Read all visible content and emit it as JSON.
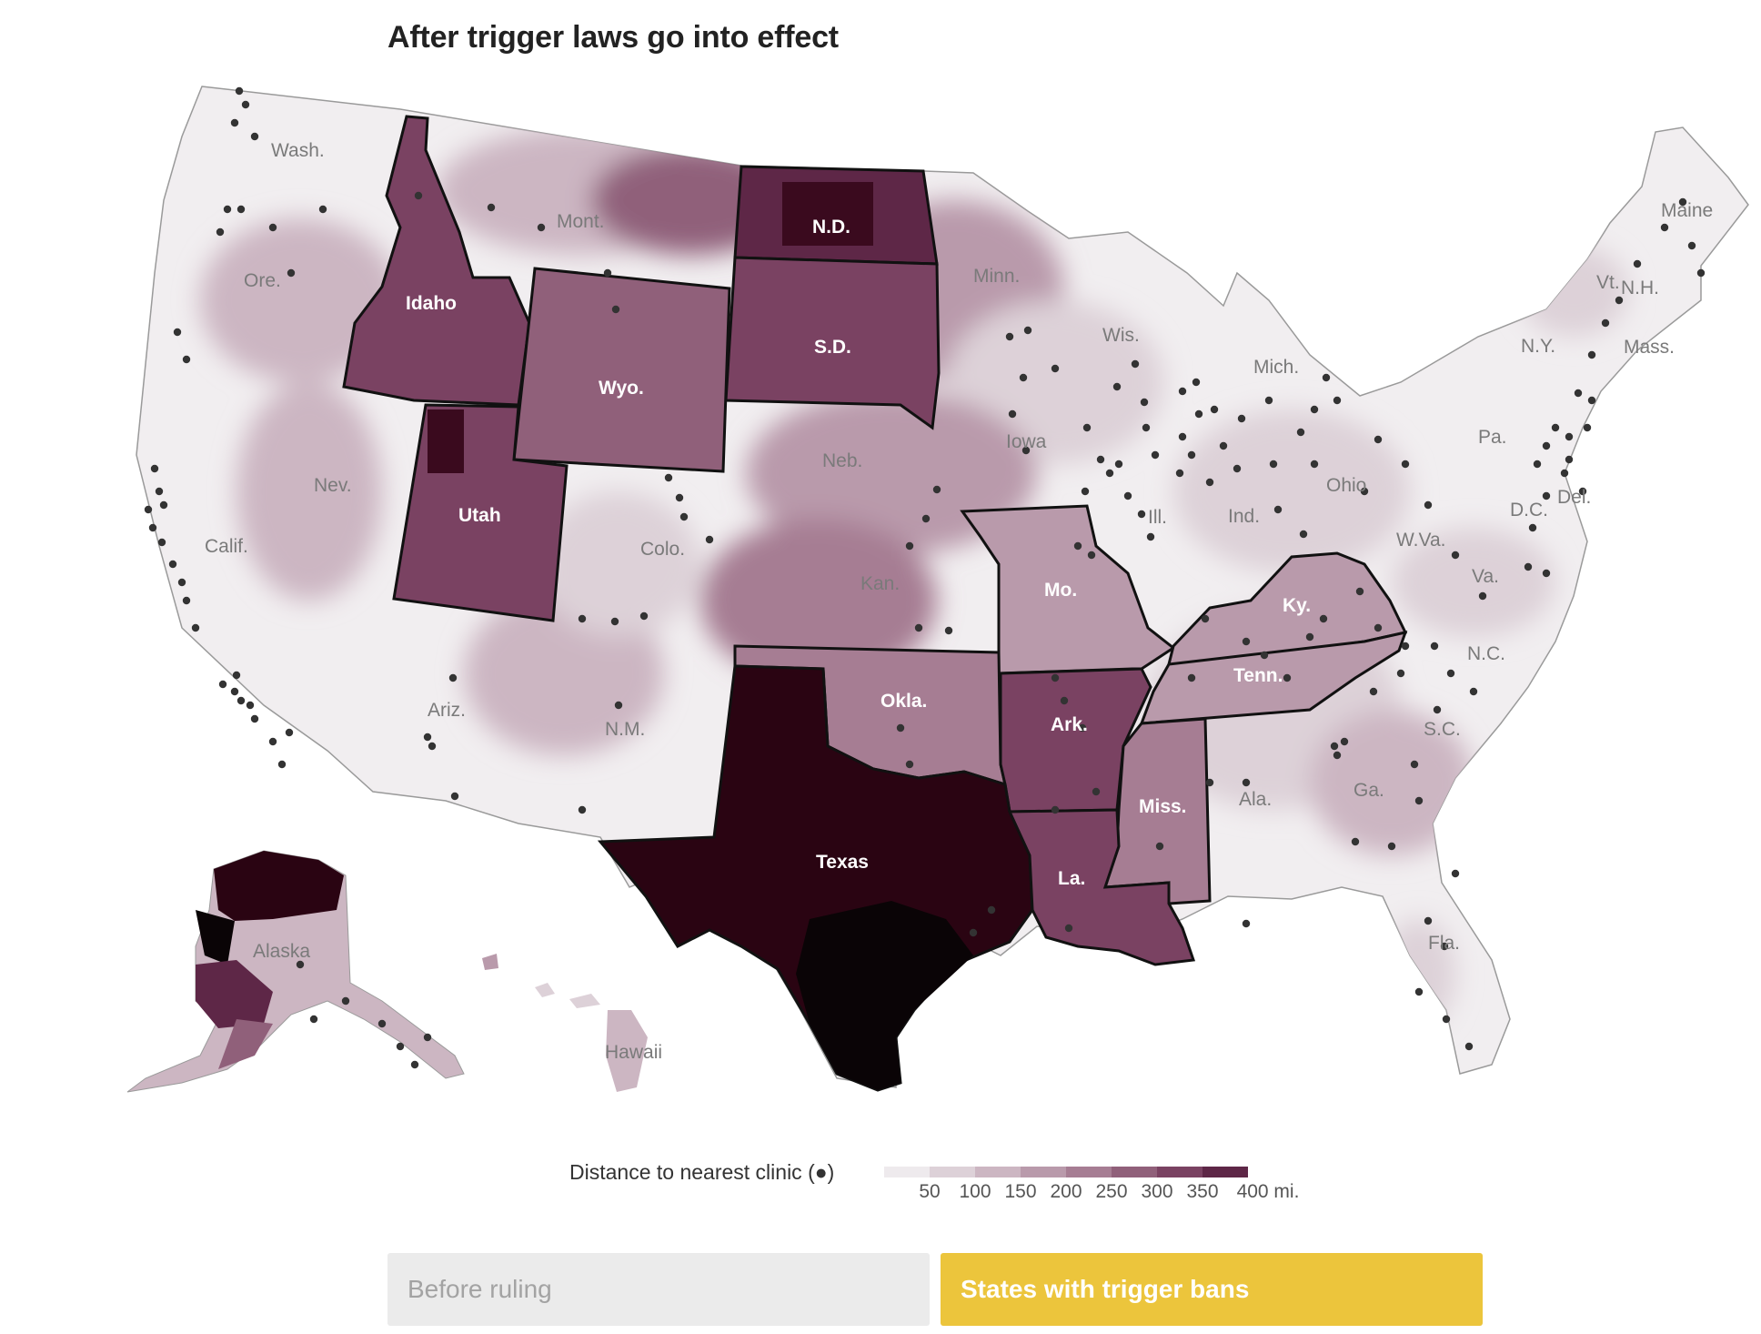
{
  "headline": "After trigger laws go into effect",
  "map": {
    "state_labels_gray": [
      {
        "id": "wash",
        "text": "Wash."
      },
      {
        "id": "ore",
        "text": "Ore."
      },
      {
        "id": "calif",
        "text": "Calif."
      },
      {
        "id": "nev",
        "text": "Nev."
      },
      {
        "id": "mont",
        "text": "Mont."
      },
      {
        "id": "ariz",
        "text": "Ariz."
      },
      {
        "id": "colo",
        "text": "Colo."
      },
      {
        "id": "nm",
        "text": "N.M."
      },
      {
        "id": "neb",
        "text": "Neb."
      },
      {
        "id": "kan",
        "text": "Kan."
      },
      {
        "id": "minn",
        "text": "Minn."
      },
      {
        "id": "iowa",
        "text": "Iowa"
      },
      {
        "id": "wis",
        "text": "Wis."
      },
      {
        "id": "mich",
        "text": "Mich."
      },
      {
        "id": "ill",
        "text": "Ill."
      },
      {
        "id": "ind",
        "text": "Ind."
      },
      {
        "id": "ohio",
        "text": "Ohio"
      },
      {
        "id": "pa",
        "text": "Pa."
      },
      {
        "id": "ny",
        "text": "N.Y."
      },
      {
        "id": "vt",
        "text": "Vt."
      },
      {
        "id": "nh",
        "text": "N.H."
      },
      {
        "id": "mass",
        "text": "Mass."
      },
      {
        "id": "maine",
        "text": "Maine"
      },
      {
        "id": "del",
        "text": "Del."
      },
      {
        "id": "dc",
        "text": "D.C."
      },
      {
        "id": "wva",
        "text": "W.Va."
      },
      {
        "id": "va",
        "text": "Va."
      },
      {
        "id": "nc",
        "text": "N.C."
      },
      {
        "id": "sc",
        "text": "S.C."
      },
      {
        "id": "ga",
        "text": "Ga."
      },
      {
        "id": "ala",
        "text": "Ala."
      },
      {
        "id": "fla",
        "text": "Fla."
      },
      {
        "id": "alaska",
        "text": "Alaska"
      },
      {
        "id": "hawaii",
        "text": "Hawaii"
      }
    ],
    "state_labels_trigger": [
      {
        "id": "nd",
        "text": "N.D."
      },
      {
        "id": "sd",
        "text": "S.D."
      },
      {
        "id": "idaho",
        "text": "Idaho"
      },
      {
        "id": "wyo",
        "text": "Wyo."
      },
      {
        "id": "utah",
        "text": "Utah"
      },
      {
        "id": "mo",
        "text": "Mo."
      },
      {
        "id": "ky",
        "text": "Ky."
      },
      {
        "id": "tenn",
        "text": "Tenn."
      },
      {
        "id": "okla",
        "text": "Okla."
      },
      {
        "id": "ark",
        "text": "Ark."
      },
      {
        "id": "miss",
        "text": "Miss."
      },
      {
        "id": "texas",
        "text": "Texas"
      },
      {
        "id": "la",
        "text": "La."
      }
    ],
    "colors": {
      "scale": [
        "#eeeaed",
        "#ddd1d8",
        "#ccb6c2",
        "#b99aab",
        "#a67d93",
        "#90607a",
        "#7a4262",
        "#5e2747"
      ],
      "darkest": "#2a0412",
      "black": "#0a0406",
      "clinic_dot": "#333333",
      "state_border": "#111111"
    }
  },
  "legend": {
    "label": "Distance to nearest clinic (●)",
    "ticks": [
      "50",
      "100",
      "150",
      "200",
      "250",
      "300",
      "350",
      "400 mi."
    ]
  },
  "buttons": {
    "before": "Before ruling",
    "trigger": "States with trigger bans"
  }
}
